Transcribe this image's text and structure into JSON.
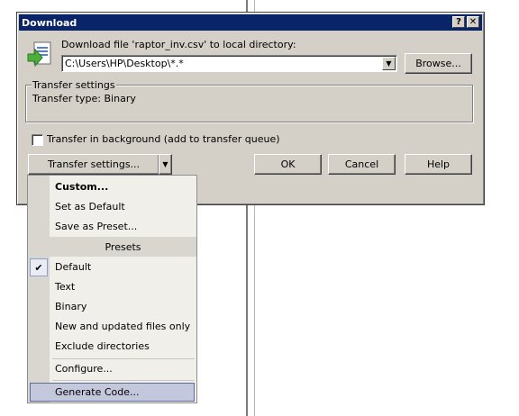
{
  "dialog": {
    "title": "Download",
    "help_btn": "?",
    "close_btn": "✕",
    "prompt": "Download file 'raptor_inv.csv' to local directory:",
    "path_value": "C:\\Users\\HP\\Desktop\\*.*",
    "browse_label": "Browse...",
    "group_title": "Transfer settings",
    "transfer_type": "Transfer type: Binary",
    "background_label": "Transfer in background (add to transfer queue)",
    "background_checked": false,
    "settings_button": "Transfer settings...",
    "ok_label": "OK",
    "cancel_label": "Cancel",
    "help_label": "Help"
  },
  "menu": {
    "custom": "Custom...",
    "set_default": "Set as Default",
    "save_preset": "Save as Preset...",
    "presets_header": "Presets",
    "preset_default": "Default",
    "preset_text": "Text",
    "preset_binary": "Binary",
    "preset_new_updated": "New and updated files only",
    "preset_exclude_dirs": "Exclude directories",
    "configure": "Configure...",
    "generate_code": "Generate Code...",
    "checked_item": "Default",
    "check_mark": "✔"
  },
  "colors": {
    "title_bar": "#0a246a",
    "dialog_face": "#d4d0c8",
    "menu_bg": "#f0efea",
    "menu_hover": "#c3c8dc"
  }
}
